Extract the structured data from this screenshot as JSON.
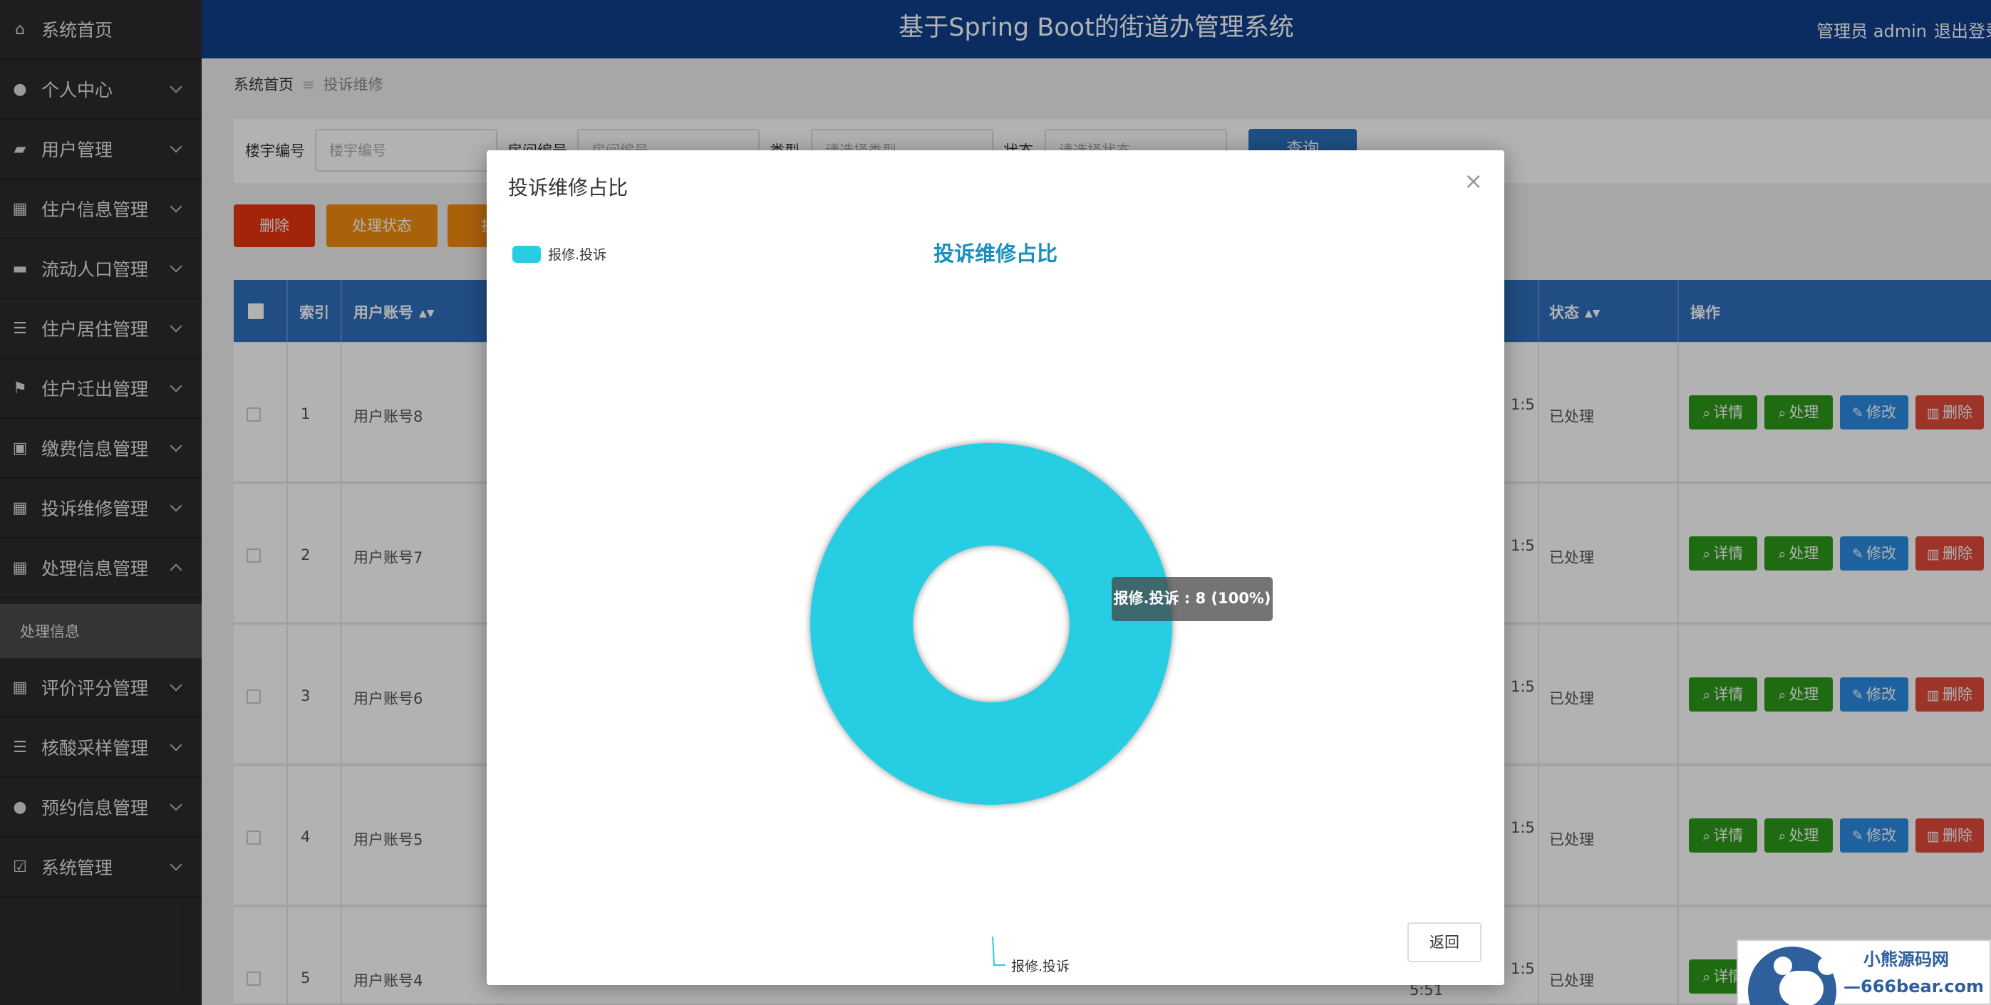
{
  "app": {
    "title": "基于Spring Boot的街道办管理系统",
    "user": "管理员 admin",
    "logout": "退出登录"
  },
  "sidebar": {
    "items": [
      {
        "label": "系统首页",
        "icon": "home-icon"
      },
      {
        "label": "个人中心",
        "icon": "person-icon"
      },
      {
        "label": "用户管理",
        "icon": "id-card-icon"
      },
      {
        "label": "住户信息管理",
        "icon": "grid-icon"
      },
      {
        "label": "流动人口管理",
        "icon": "message-icon"
      },
      {
        "label": "住户居住管理",
        "icon": "list-icon"
      },
      {
        "label": "住户迁出管理",
        "icon": "flag-icon"
      },
      {
        "label": "缴费信息管理",
        "icon": "briefcase-icon"
      },
      {
        "label": "投诉维修管理",
        "icon": "grid-icon"
      },
      {
        "label": "处理信息管理",
        "icon": "grid-icon"
      },
      {
        "label": "评价评分管理",
        "icon": "grid-icon"
      },
      {
        "label": "核酸采样管理",
        "icon": "list-icon"
      },
      {
        "label": "预约信息管理",
        "icon": "person-icon"
      },
      {
        "label": "系统管理",
        "icon": "check-square-icon"
      }
    ],
    "sub_item": "处理信息"
  },
  "breadcrumb": {
    "home": "系统首页",
    "current": "投诉维修"
  },
  "search": {
    "building_label": "楼宇编号",
    "building_placeholder": "楼宇编号",
    "room_label": "房间编号",
    "room_placeholder": "房间编号",
    "type_label": "类型",
    "type_placeholder": "请选择类型",
    "status_label": "状态",
    "status_placeholder": "请选择状态",
    "query_button": "查询"
  },
  "actions": {
    "delete": "删除",
    "process_status": "处理状态",
    "stats": "投诉维修占比"
  },
  "table": {
    "headers": {
      "index": "索引",
      "account": "用户账号",
      "status": "状态",
      "ops": "操作"
    },
    "rows": [
      {
        "index": "1",
        "account": "用户账号8",
        "time": "1:5",
        "status": "已处理"
      },
      {
        "index": "2",
        "account": "用户账号7",
        "time": "1:5",
        "status": "已处理"
      },
      {
        "index": "3",
        "account": "用户账号6",
        "time": "1:5",
        "status": "已处理"
      },
      {
        "index": "4",
        "account": "用户账号5",
        "time": "1:5",
        "status": "已处理"
      },
      {
        "index": "5",
        "account": "用户账号4",
        "time": "1:5",
        "status": "已处理",
        "time2": "5:51"
      }
    ],
    "row_buttons": {
      "detail": "详情",
      "process": "处理",
      "edit": "修改",
      "delete": "删除"
    }
  },
  "modal": {
    "title": "投诉维修占比",
    "close": "×",
    "return_button": "返回",
    "tooltip": "报修.投诉 : 8 (100%)"
  },
  "chart_data": {
    "type": "pie",
    "title": "投诉维修占比",
    "legend_position": "top-left",
    "series": [
      {
        "name": "报修.投诉",
        "values": [
          8
        ],
        "percent": 100,
        "color": "#27cde3"
      }
    ],
    "slice_label": "报修.投诉"
  },
  "watermark": {
    "text_cn": "小熊源码网",
    "url": "—666bear.com—"
  },
  "colors": {
    "header_bg": "#0f3f8c",
    "sidebar_bg": "#2b2c2f",
    "table_head_bg": "#2e6fbd",
    "btn_red": "#e8340f",
    "btn_orange": "#f28c0f",
    "btn_green": "#2b9a1b",
    "btn_blue": "#2a8be3",
    "btn_delete": "#e04b3c",
    "chart_slice": "#27cde3",
    "chart_title": "#1a8fbb"
  }
}
